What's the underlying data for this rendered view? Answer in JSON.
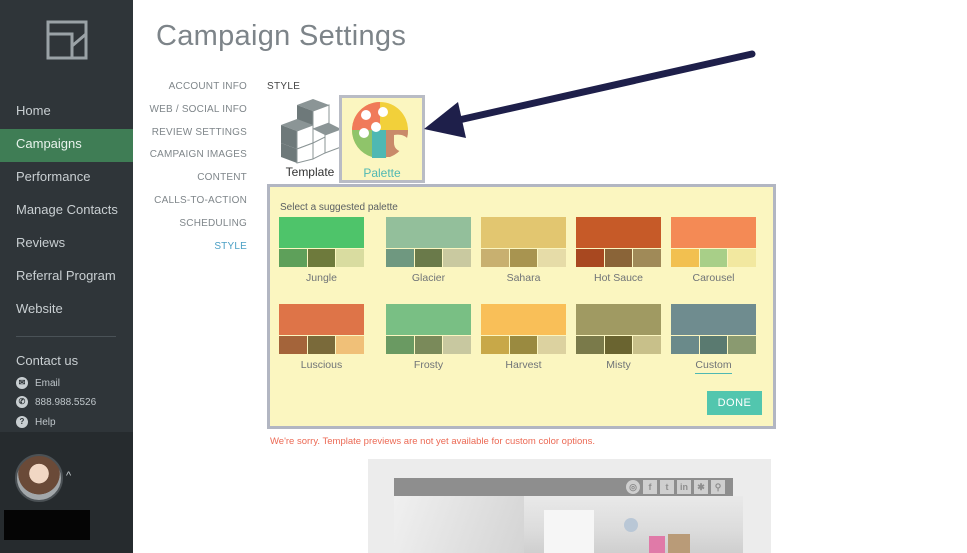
{
  "sidebar": {
    "nav": [
      {
        "label": "Home",
        "active": false
      },
      {
        "label": "Campaigns",
        "active": true
      },
      {
        "label": "Performance",
        "active": false
      },
      {
        "label": "Manage Contacts",
        "active": false
      },
      {
        "label": "Reviews",
        "active": false
      },
      {
        "label": "Referral Program",
        "active": false
      },
      {
        "label": "Website",
        "active": false
      }
    ],
    "contact_title": "Contact us",
    "contact_email": "Email",
    "contact_phone": "888.988.5526",
    "contact_help": "Help",
    "profile_caret": "^"
  },
  "page": {
    "title": "Campaign Settings"
  },
  "settings_nav": [
    {
      "label": "ACCOUNT INFO",
      "active": false
    },
    {
      "label": "WEB / SOCIAL INFO",
      "active": false
    },
    {
      "label": "REVIEW SETTINGS",
      "active": false
    },
    {
      "label": "CAMPAIGN IMAGES",
      "active": false
    },
    {
      "label": "CONTENT",
      "active": false
    },
    {
      "label": "CALLS-TO-ACTION",
      "active": false
    },
    {
      "label": "SCHEDULING",
      "active": false
    },
    {
      "label": "STYLE",
      "active": true
    }
  ],
  "style": {
    "section_label": "STYLE",
    "template_label": "Template",
    "palette_label": "Palette"
  },
  "palette_panel": {
    "title": "Select a suggested palette",
    "palettes": [
      {
        "name": "Jungle",
        "top": "#4ec46a",
        "bottom": [
          "#5ea05a",
          "#6e7a3c",
          "#d9dca0"
        ]
      },
      {
        "name": "Glacier",
        "top": "#93bf9b",
        "bottom": [
          "#6f9880",
          "#6a7a4a",
          "#c9c9a0"
        ]
      },
      {
        "name": "Sahara",
        "top": "#e2c670",
        "bottom": [
          "#c8b070",
          "#a89450",
          "#e6dca8"
        ]
      },
      {
        "name": "Hot Sauce",
        "top": "#c65a28",
        "bottom": [
          "#a84820",
          "#8a6438",
          "#a08a58"
        ]
      },
      {
        "name": "Carousel",
        "top": "#f48a55",
        "bottom": [
          "#f2c050",
          "#a8cf88",
          "#f2e8a0"
        ]
      },
      {
        "name": "Luscious",
        "top": "#de7448",
        "bottom": [
          "#a4643a",
          "#7a6a3a",
          "#f0c078"
        ]
      },
      {
        "name": "Frosty",
        "top": "#79bf84",
        "bottom": [
          "#6a9a62",
          "#7a8a5a",
          "#c8c8a0"
        ]
      },
      {
        "name": "Harvest",
        "top": "#f9bf58",
        "bottom": [
          "#c8a848",
          "#9a8a40",
          "#dcd2a0"
        ]
      },
      {
        "name": "Misty",
        "top": "#a09a62",
        "bottom": [
          "#7a7a4a",
          "#6a6430",
          "#c8c08a"
        ]
      },
      {
        "name": "Custom",
        "top": "#6f8c8f",
        "bottom": [
          "#6a8a8a",
          "#5a7a70",
          "#8a9a70"
        ]
      }
    ],
    "done_label": "DONE"
  },
  "warning": "We're sorry. Template previews are not yet available for custom color options.",
  "colors": {
    "sidebar_bg": "#2f3539",
    "active_nav": "#3f7d55",
    "panel_bg": "#fbf6c0",
    "accent": "#4fb8b3",
    "done_button": "#52c6ae",
    "warning": "#ec6a55",
    "arrow": "#1e1f4a"
  },
  "icons": {
    "logo": "folded-square-logo-icon",
    "template": "cubes-template-icon",
    "palette": "artist-palette-icon",
    "email": "mail-icon",
    "phone": "phone-icon",
    "help": "question-icon",
    "social": [
      "globe-icon",
      "facebook-icon",
      "twitter-icon",
      "linkedin-icon",
      "yelp-icon",
      "location-pin-icon"
    ]
  }
}
